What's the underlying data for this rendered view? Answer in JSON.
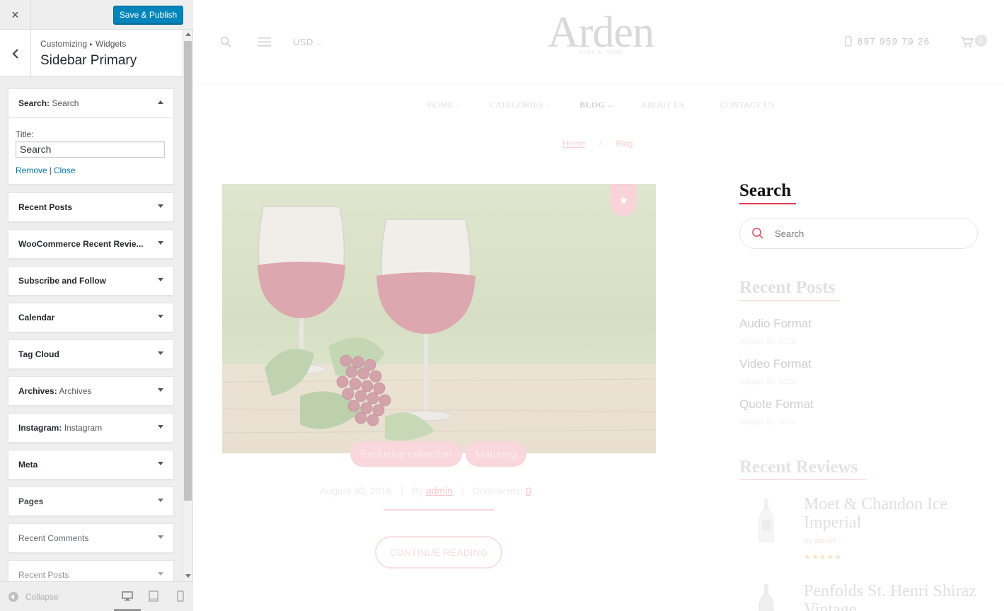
{
  "customizer": {
    "close_label": "×",
    "save_label": "Save & Publish",
    "breadcrumb": [
      "Customizing",
      "Widgets"
    ],
    "section_title": "Sidebar Primary",
    "widgets": [
      {
        "name": "Search",
        "instance": "Search",
        "expanded": true,
        "title_label": "Title:",
        "title_value": "Search",
        "remove_label": "Remove",
        "close_label": "Close"
      },
      {
        "name": "Recent Posts"
      },
      {
        "name": "WooCommerce Recent Revie..."
      },
      {
        "name": "Subscribe and Follow"
      },
      {
        "name": "Calendar"
      },
      {
        "name": "Tag Cloud"
      },
      {
        "name": "Archives",
        "instance": "Archives"
      },
      {
        "name": "Instagram",
        "instance": "Instagram"
      },
      {
        "name": "Meta"
      },
      {
        "name": "Pages"
      },
      {
        "name": "Recent Comments"
      },
      {
        "name": "Recent Posts"
      }
    ],
    "collapse_label": "Collapse",
    "devices": [
      "desktop",
      "tablet",
      "mobile"
    ],
    "accent_color": "#0085ba"
  },
  "preview": {
    "currency": "USD",
    "logo_text": "Arden",
    "logo_tagline": "WINE & FOOD",
    "phone": "897 959 79 26",
    "cart_count": "0",
    "nav": [
      {
        "label": "HOME",
        "has_dropdown": true
      },
      {
        "label": "CATEGORIES",
        "has_dropdown": true
      },
      {
        "label": "BLOG",
        "has_dropdown": true,
        "active": true
      },
      {
        "label": "ABOUT US",
        "has_dropdown": false
      },
      {
        "label": "CONTACT US",
        "has_dropdown": false
      }
    ],
    "breadcrumb": {
      "home": "Home",
      "separator": "/",
      "current": "Blog"
    },
    "post": {
      "tags": [
        "Exclusive collection",
        "Maturing"
      ],
      "date": "August 30, 2016",
      "by_label": "By",
      "author": "admin",
      "comments_label": "Comments:",
      "comments_count": "0",
      "continue_label": "CONTINUE READING"
    },
    "sidebar": {
      "search_title": "Search",
      "search_placeholder": "Search",
      "recent_posts_title": "Recent Posts",
      "recent_posts": [
        {
          "title": "Audio Format",
          "date": "August 30, 2016"
        },
        {
          "title": "Video Format",
          "date": "August 30, 2016"
        },
        {
          "title": "Quote Format",
          "date": "August 30, 2016"
        }
      ],
      "recent_reviews_title": "Recent Reviews",
      "reviews": [
        {
          "product": "Moet & Chandon Ice Imperial",
          "by": "by admin",
          "stars": "★★★★★"
        },
        {
          "product": "Penfolds St. Henri Shiraz Vintage"
        }
      ],
      "accent_color": "#e23a52"
    }
  }
}
